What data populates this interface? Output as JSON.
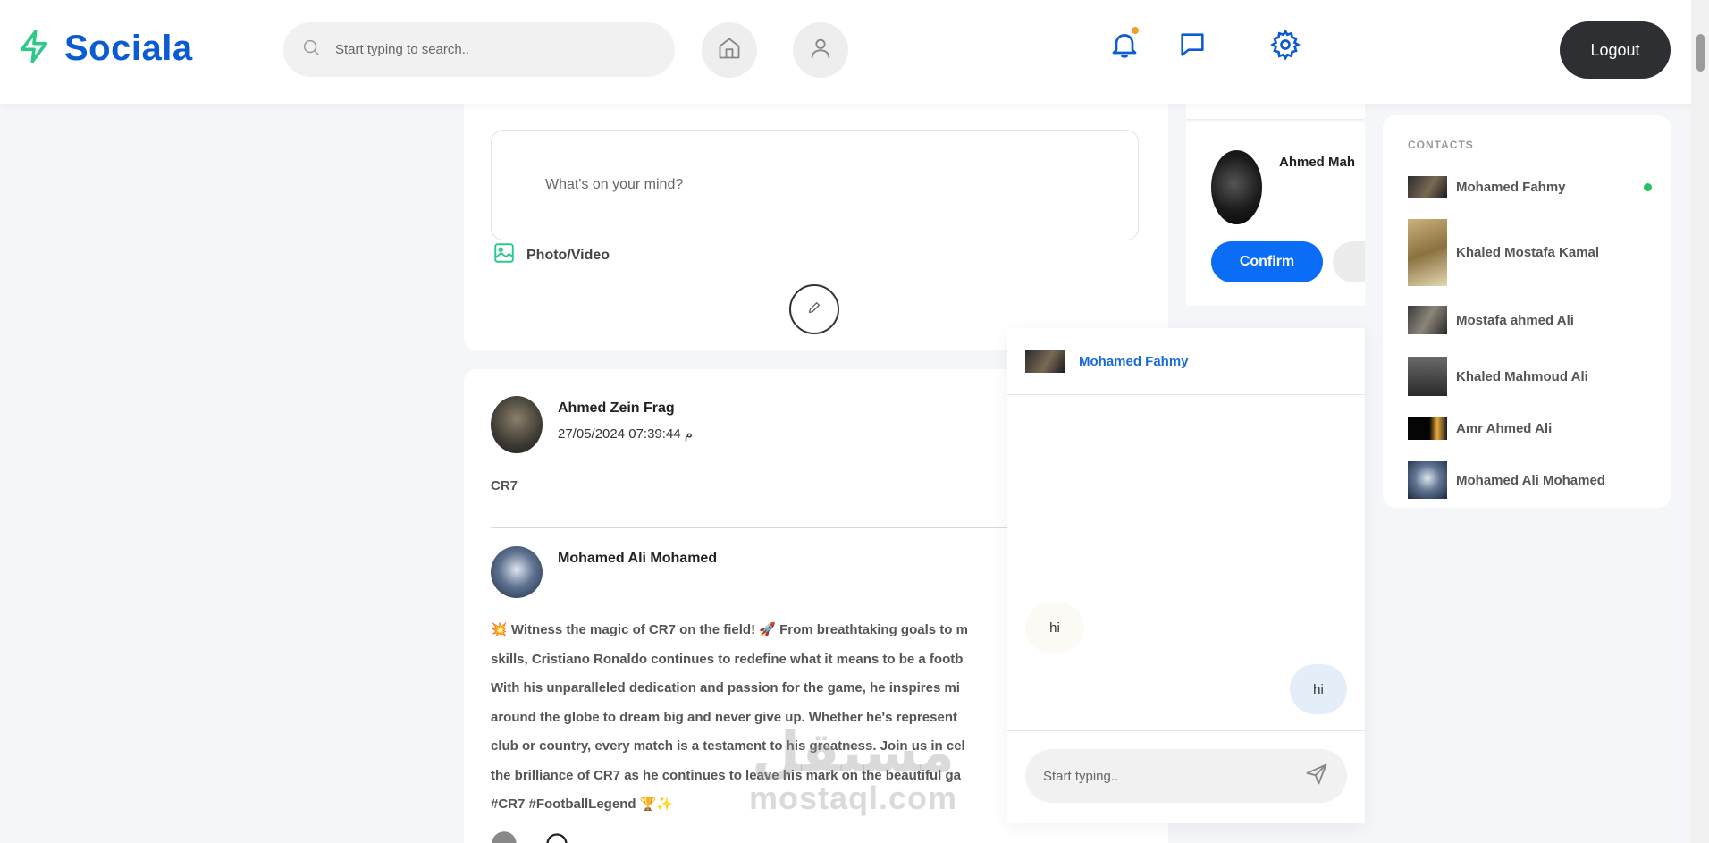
{
  "app": {
    "name": "Sociala"
  },
  "header": {
    "search_placeholder": "Start typing to search..",
    "logout_label": "Logout",
    "icons": [
      "bolt-icon",
      "search-icon",
      "home-icon",
      "user-icon",
      "bell-icon",
      "chat-icon",
      "gear-icon"
    ],
    "accent": "#0b5bd3",
    "notification_dot_color": "#f0a030"
  },
  "create_post": {
    "placeholder": "What's on your mind?",
    "photo_label": "Photo/Video"
  },
  "post": {
    "author": "Ahmed Zein Frag",
    "date": "27/05/2024 07:39:44 م",
    "text": "CR7",
    "shared": {
      "author": "Mohamed Ali Mohamed",
      "lines": [
        "💥 Witness the magic of CR7 on the field! 🚀 From breathtaking goals to m",
        "skills, Cristiano Ronaldo continues to redefine what it means to be a footb",
        "With his unparalleled dedication and passion for the game, he inspires mi",
        "around the globe to dream big and never give up. Whether he's represent",
        "club or country, every match is a testament to his greatness. Join us in cel",
        "the brilliance of CR7 as he continues to leave his mark on the beautiful ga",
        "#CR7 #FootballLegend 🏆✨"
      ]
    }
  },
  "friend_request": {
    "name": "Ahmed Mah",
    "confirm_label": "Confirm"
  },
  "contacts": {
    "title": "CONTACTS",
    "items": [
      {
        "name": "Mohamed Fahmy",
        "online": true
      },
      {
        "name": "Khaled Mostafa Kamal",
        "online": false
      },
      {
        "name": "Mostafa ahmed Ali",
        "online": false
      },
      {
        "name": "Khaled Mahmoud Ali",
        "online": false
      },
      {
        "name": "Amr Ahmed Ali",
        "online": false
      },
      {
        "name": "Mohamed Ali Mohamed",
        "online": false
      }
    ],
    "online_color": "#22c55e"
  },
  "chat": {
    "contact_name": "Mohamed Fahmy",
    "messages": [
      {
        "direction": "in",
        "text": "hi"
      },
      {
        "direction": "out",
        "text": "hi"
      }
    ],
    "input_placeholder": "Start typing.."
  },
  "watermark": {
    "arabic": "مستقل",
    "latin": "mostaql.com"
  }
}
